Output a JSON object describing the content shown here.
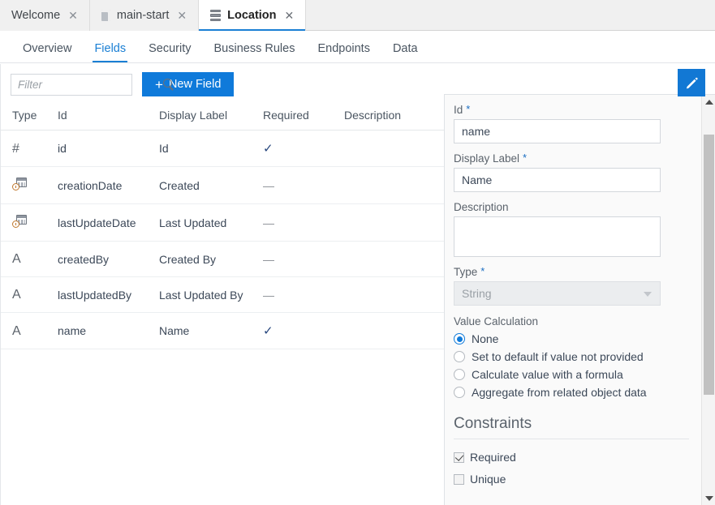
{
  "editor_tabs": [
    {
      "label": "Welcome",
      "icon": "",
      "active": false,
      "close": "✕"
    },
    {
      "label": "main-start",
      "icon": "file-icon",
      "active": false,
      "close": "✕"
    },
    {
      "label": "Location",
      "icon": "database-icon",
      "active": true,
      "close": "✕"
    }
  ],
  "subnav": [
    {
      "label": "Overview",
      "active": false
    },
    {
      "label": "Fields",
      "active": true
    },
    {
      "label": "Security",
      "active": false
    },
    {
      "label": "Business Rules",
      "active": false
    },
    {
      "label": "Endpoints",
      "active": false
    },
    {
      "label": "Data",
      "active": false
    }
  ],
  "toolbar": {
    "filter_placeholder": "Filter",
    "filter_value": "",
    "search_icon": "search-icon",
    "new_field_label": "New Field",
    "new_field_plus": "+",
    "accent_color": "#0f7ada"
  },
  "table": {
    "headers": [
      "Type",
      "Id",
      "Display Label",
      "Required",
      "Description"
    ],
    "rows": [
      {
        "type_icon": "number-icon",
        "type_glyph": "#",
        "id": "id",
        "label": "Id",
        "required": "✓",
        "required_bool": true,
        "description": ""
      },
      {
        "type_icon": "date-icon",
        "type_glyph": "",
        "id": "creationDate",
        "label": "Created",
        "required": "—",
        "required_bool": false,
        "description": ""
      },
      {
        "type_icon": "date-icon",
        "type_glyph": "",
        "id": "lastUpdateDate",
        "label": "Last Updated",
        "required": "—",
        "required_bool": false,
        "description": ""
      },
      {
        "type_icon": "string-icon",
        "type_glyph": "A",
        "id": "createdBy",
        "label": "Created By",
        "required": "—",
        "required_bool": false,
        "description": ""
      },
      {
        "type_icon": "string-icon",
        "type_glyph": "A",
        "id": "lastUpdatedBy",
        "label": "Last Updated By",
        "required": "—",
        "required_bool": false,
        "description": ""
      },
      {
        "type_icon": "string-icon",
        "type_glyph": "A",
        "id": "name",
        "label": "Name",
        "required": "✓",
        "required_bool": true,
        "description": ""
      }
    ]
  },
  "detail": {
    "edit_button_icon": "pencil-icon",
    "id_label": "Id",
    "id_required_star": "*",
    "id_value": "name",
    "display_label_label": "Display Label",
    "display_label_star": "*",
    "display_label_value": "Name",
    "description_label": "Description",
    "description_value": "",
    "type_label": "Type",
    "type_star": "*",
    "type_value": "String",
    "value_calculation_label": "Value Calculation",
    "value_calculation_options": [
      {
        "label": "None",
        "selected": true
      },
      {
        "label": "Set to default if value not provided",
        "selected": false
      },
      {
        "label": "Calculate value with a formula",
        "selected": false
      },
      {
        "label": "Aggregate from related object data",
        "selected": false
      }
    ],
    "constraints_title": "Constraints",
    "constraints": [
      {
        "label": "Required",
        "checked": true
      },
      {
        "label": "Unique",
        "checked": false
      }
    ]
  }
}
